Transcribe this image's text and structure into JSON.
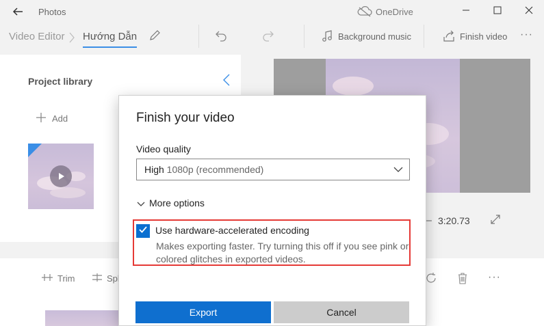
{
  "titlebar": {
    "app_name": "Photos",
    "cloud_label": "OneDrive",
    "back_icon": "back-arrow-icon",
    "minimize_icon": "minimize-icon",
    "maximize_icon": "maximize-icon",
    "close_icon": "close-icon"
  },
  "toolbar": {
    "breadcrumb_root": "Video Editor",
    "breadcrumb_current": "Hướng Dẫn",
    "background_music_label": "Background music",
    "finish_video_label": "Finish video",
    "more_label": "···"
  },
  "library": {
    "title": "Project library",
    "add_label": "Add"
  },
  "player": {
    "duration": "3:20.73"
  },
  "storyboard": {
    "trim_label": "Trim",
    "split_label": "Spl",
    "more_label": "···"
  },
  "dialog": {
    "title": "Finish your video",
    "quality_label": "Video quality",
    "quality_value_main": "High",
    "quality_value_hint": " 1080p (recommended)",
    "more_options_label": "More options",
    "hw_label": "Use hardware-accelerated encoding",
    "hw_checked": true,
    "hw_description": "Makes exporting faster. Try turning this off if you see pink or colored glitches in exported videos.",
    "export_label": "Export",
    "cancel_label": "Cancel"
  },
  "colors": {
    "accent": "#0f6fcf",
    "highlight_box": "#e53935"
  }
}
